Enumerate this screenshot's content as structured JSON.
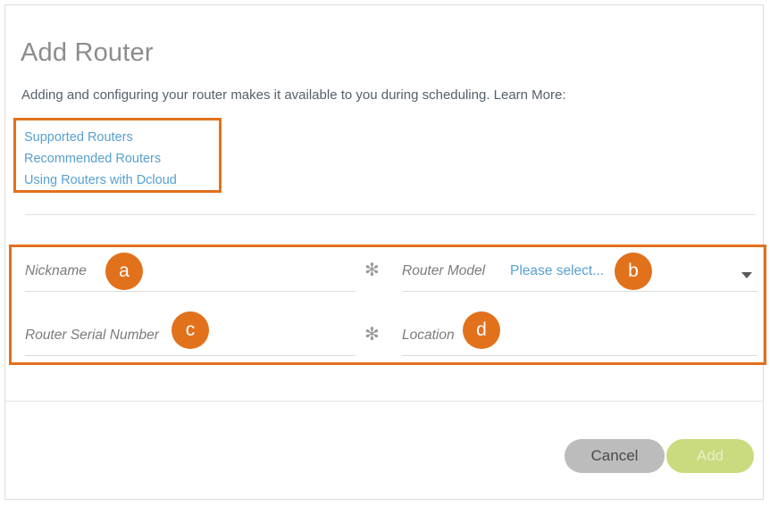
{
  "dialog": {
    "title": "Add Router",
    "subtitle": "Adding and configuring your router makes it available to you during scheduling. Learn More:"
  },
  "links": [
    {
      "label": "Supported Routers"
    },
    {
      "label": "Recommended Routers"
    },
    {
      "label": "Using Routers with Dcloud"
    }
  ],
  "form": {
    "fields": [
      {
        "id": "nickname",
        "label": "Nickname",
        "value": "",
        "required": true,
        "required_marker": "✻",
        "type": "text"
      },
      {
        "id": "router_model",
        "label": "Router Model",
        "value": "Please select...",
        "required": false,
        "type": "select",
        "caret": "chevron-down-icon"
      },
      {
        "id": "router_serial_number",
        "label": "Router Serial Number",
        "value": "",
        "required": true,
        "required_marker": "✻",
        "type": "text"
      },
      {
        "id": "location",
        "label": "Location",
        "value": "",
        "required": false,
        "type": "text"
      }
    ]
  },
  "annotations": [
    {
      "id": "a",
      "label": "a",
      "target": "nickname"
    },
    {
      "id": "b",
      "label": "b",
      "target": "router_model"
    },
    {
      "id": "c",
      "label": "c",
      "target": "router_serial_number"
    },
    {
      "id": "d",
      "label": "d",
      "target": "location"
    }
  ],
  "footer": {
    "cancel_label": "Cancel",
    "add_label": "Add",
    "add_disabled": true
  },
  "colors": {
    "annotation_orange": "#e2711c",
    "link_blue": "#58a0cf",
    "title_gray": "#8d8d8d",
    "body_text": "#55606b",
    "cancel_button": "#bcbcbc",
    "add_button": "#cada7e",
    "field_underline": "#dddddd",
    "card_border": "#dcdcdc"
  }
}
